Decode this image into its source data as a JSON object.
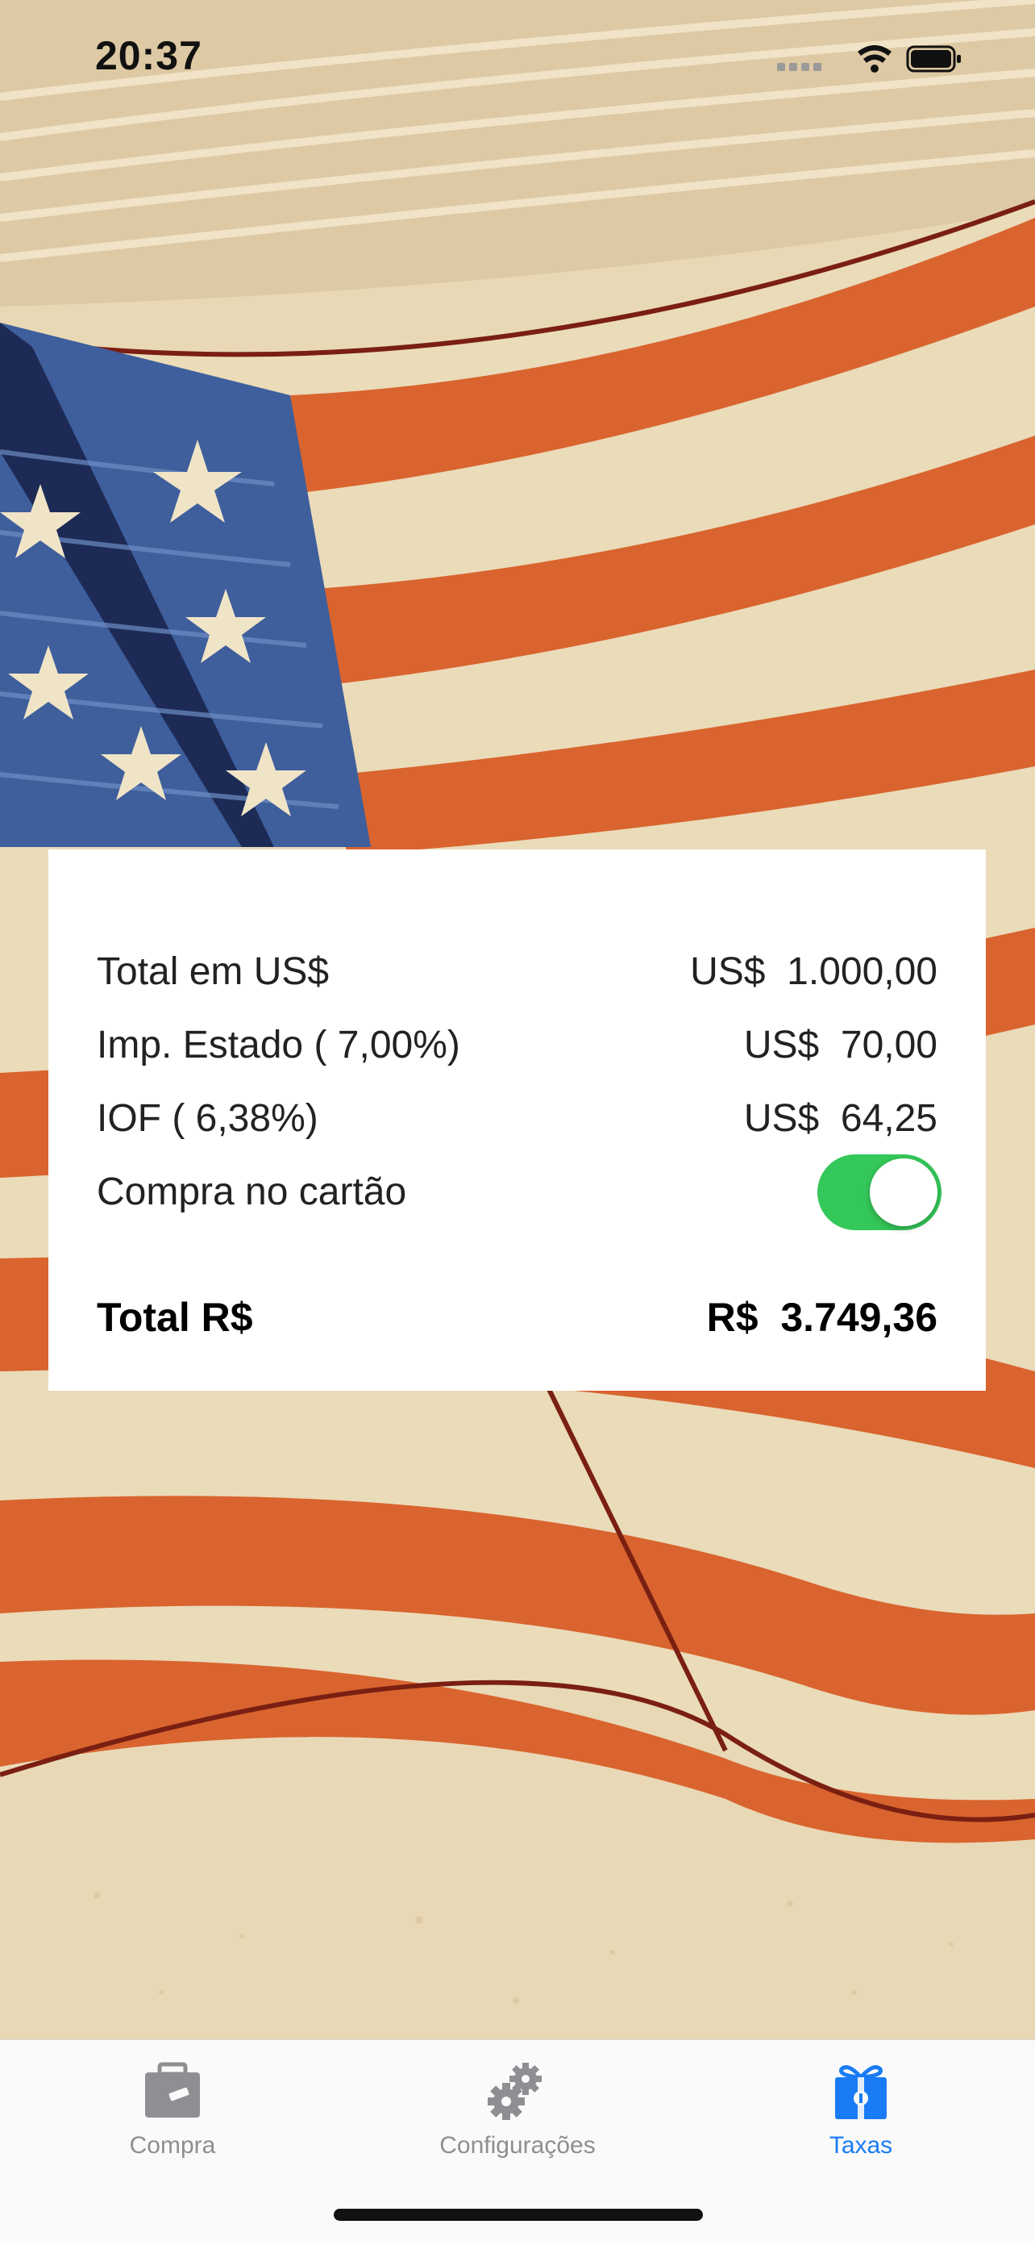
{
  "status_bar": {
    "time": "20:37"
  },
  "summary": {
    "total_usd_label": "Total em US$",
    "total_usd_value": "US$  1.000,00",
    "state_tax_label": "Imp. Estado ( 7,00%)",
    "state_tax_value": "US$  70,00",
    "iof_label": "IOF ( 6,38%)",
    "iof_value": "US$  64,25",
    "card_purchase_label": "Compra no cartão",
    "card_purchase_on": true,
    "total_brl_label": "Total R$",
    "total_brl_value": "R$  3.749,36"
  },
  "tab_bar": {
    "items": [
      {
        "label": "Compra",
        "icon": "briefcase-icon",
        "active": false
      },
      {
        "label": "Configurações",
        "icon": "gears-icon",
        "active": false
      },
      {
        "label": "Taxas",
        "icon": "gift-icon",
        "active": true
      }
    ]
  },
  "colors": {
    "accent": "#1a7cf5",
    "switch_on": "#34c759",
    "inactive_tab": "#8e8e93"
  }
}
